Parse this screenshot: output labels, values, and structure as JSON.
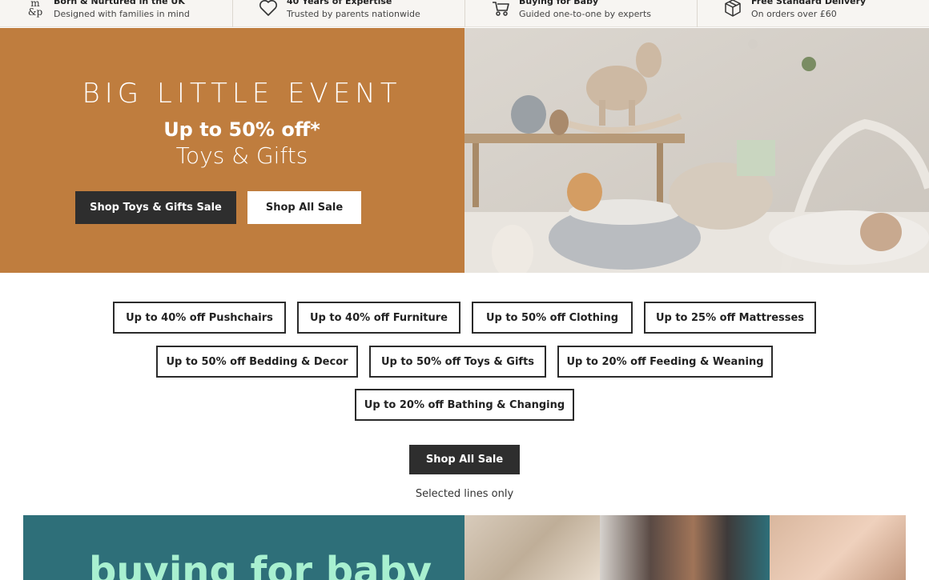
{
  "usp": [
    {
      "title": "Born & Nurtured in the UK",
      "subtitle": "Designed with families in mind",
      "icon": "mp-logo-icon"
    },
    {
      "title": "40 Years of Expertise",
      "subtitle": "Trusted by parents nationwide",
      "icon": "heart-icon"
    },
    {
      "title": "Buying for Baby",
      "subtitle": "Guided one-to-one by experts",
      "icon": "pram-icon"
    },
    {
      "title": "Free Standard Delivery",
      "subtitle": "On orders over £60",
      "icon": "box-icon"
    }
  ],
  "hero": {
    "title": "BIG LITTLE EVENT",
    "offer": "Up to 50% off*",
    "subtitle": "Toys & Gifts",
    "primary_button": "Shop Toys & Gifts Sale",
    "secondary_button": "Shop All Sale",
    "background_color": "#bf7d3e"
  },
  "categories": [
    "Up to 40% off Pushchairs",
    "Up to 40% off Furniture",
    "Up to 50% off Clothing",
    "Up to 25% off Mattresses",
    "Up to 50% off Bedding & Decor",
    "Up to 50% off Toys & Gifts",
    "Up to 20% off Feeding & Weaning",
    "Up to 20% off Bathing & Changing"
  ],
  "cta": {
    "label": "Shop All Sale",
    "note": "Selected lines only"
  },
  "bottom_banner": {
    "title": "buying for baby",
    "background_color": "#2e6f79",
    "title_color": "#a8f0d0"
  }
}
